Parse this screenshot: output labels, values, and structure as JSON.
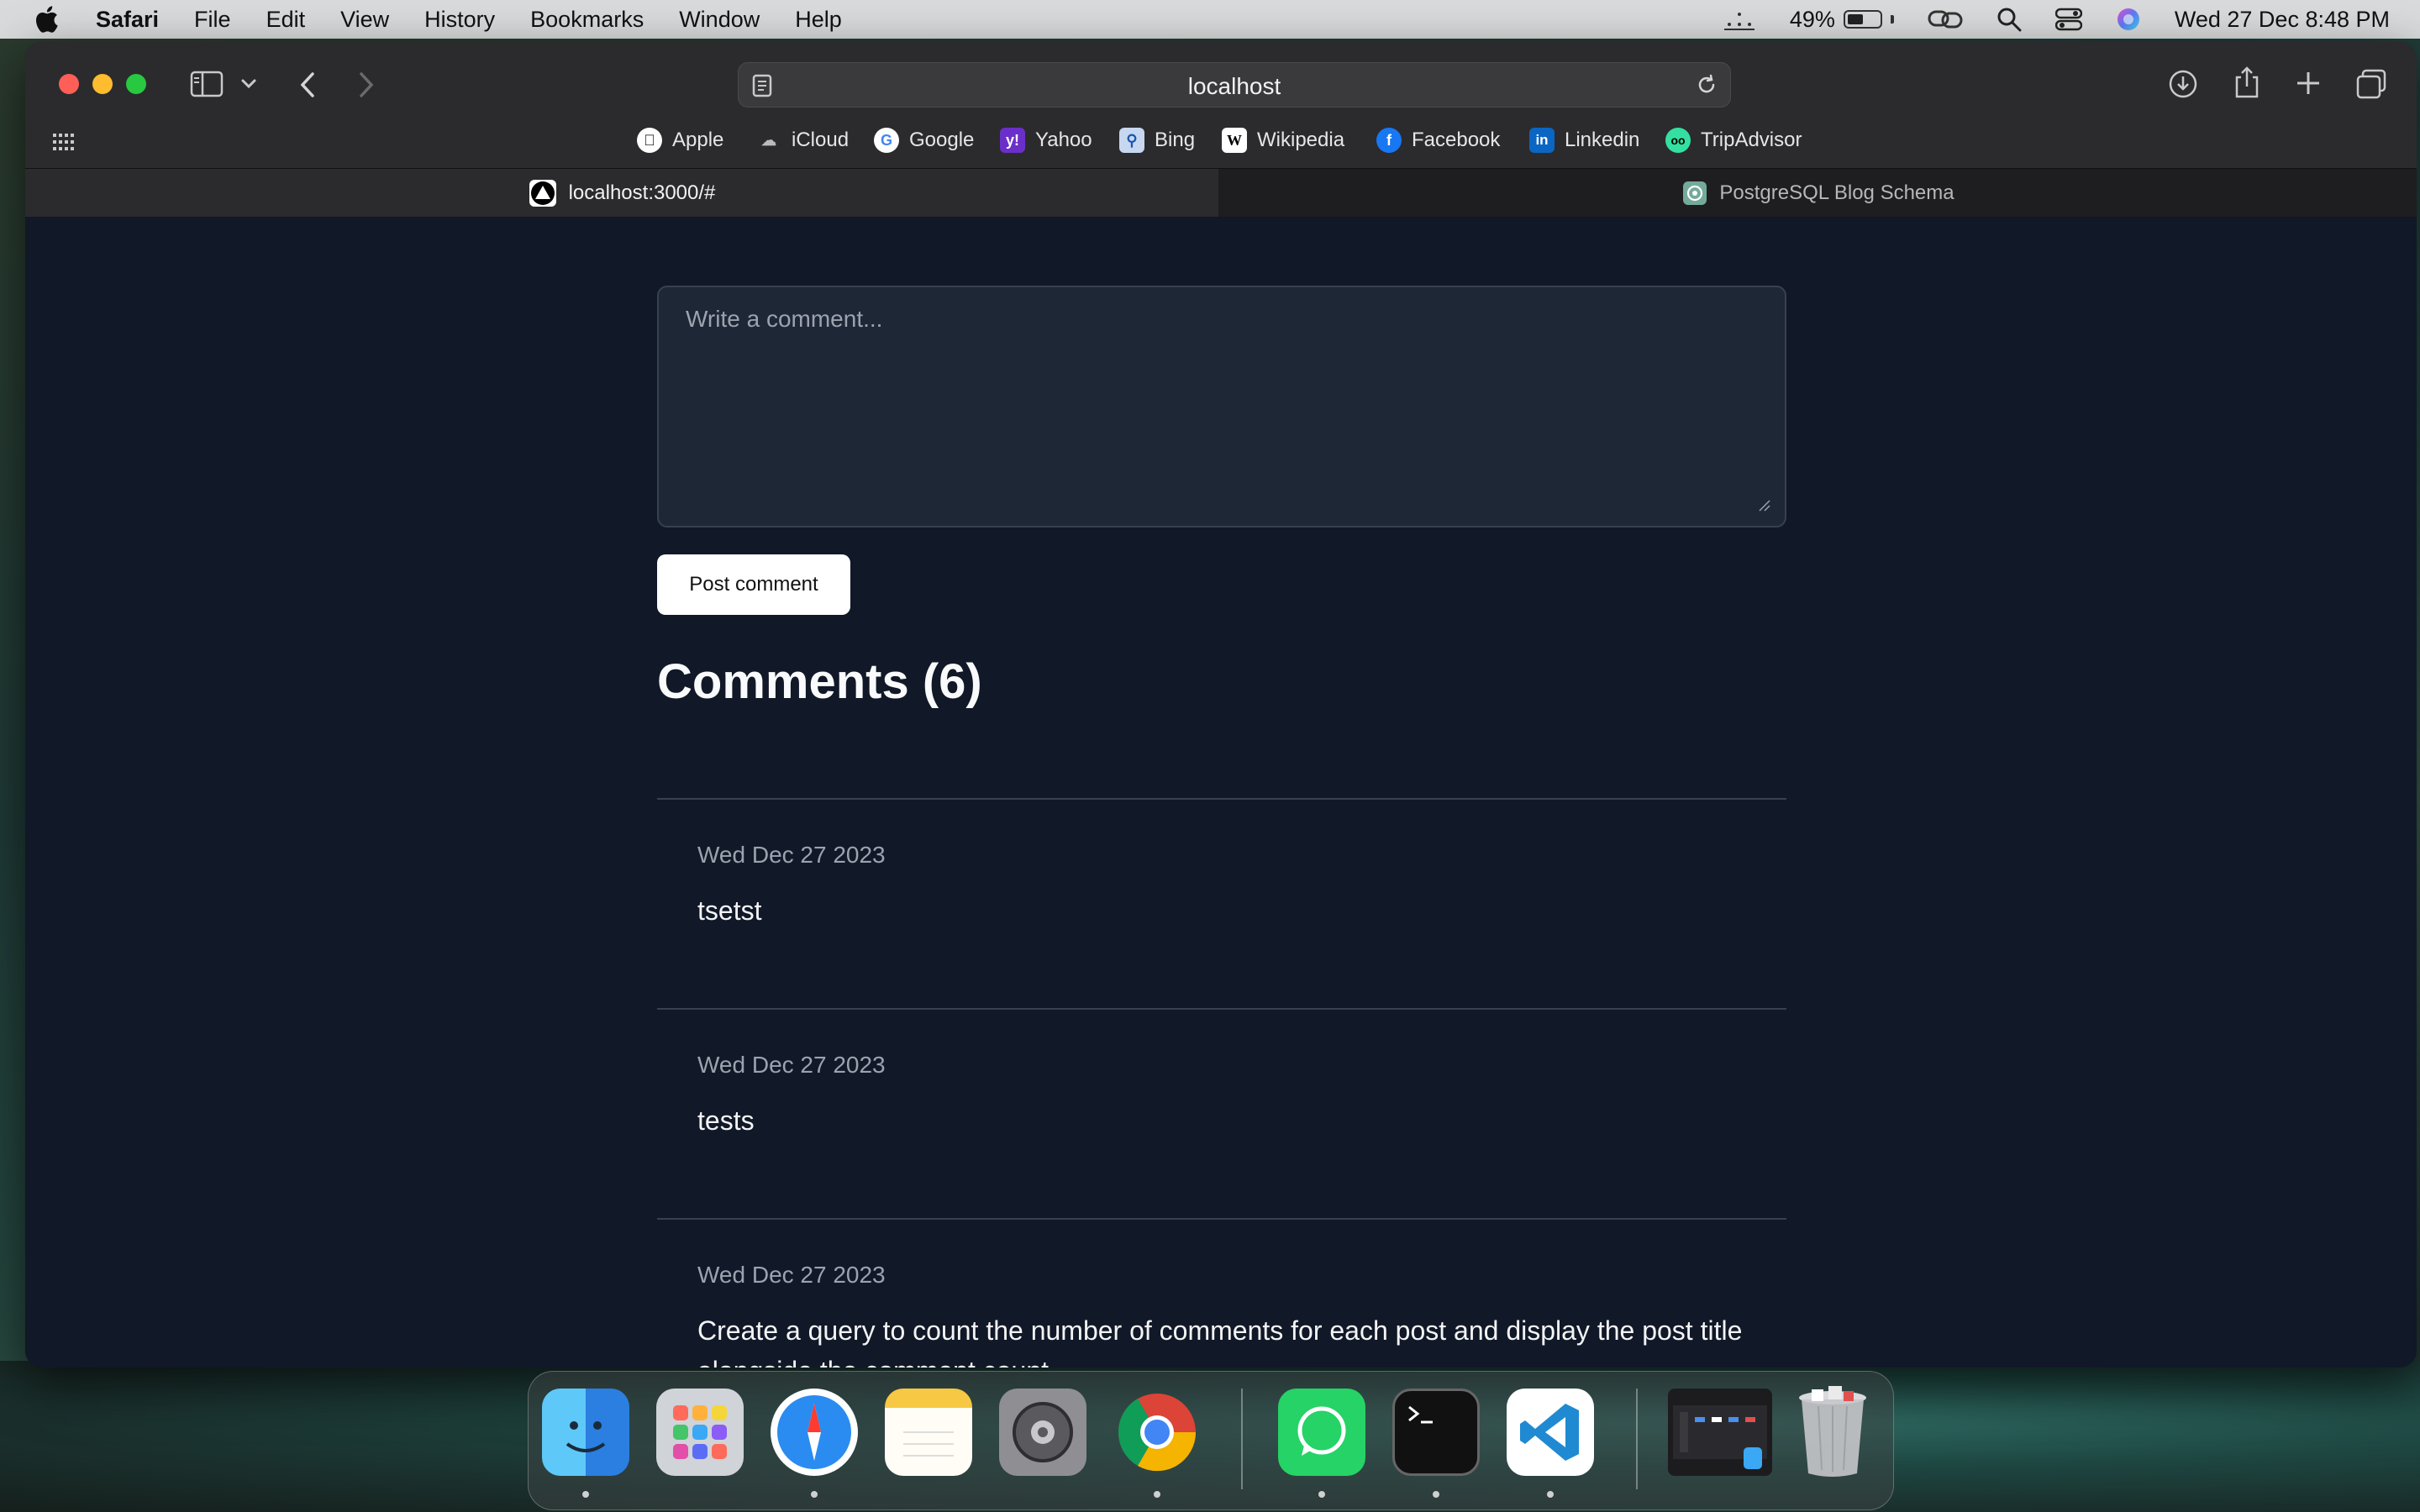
{
  "menubar": {
    "app_name": "Safari",
    "items": [
      "File",
      "Edit",
      "View",
      "History",
      "Bookmarks",
      "Window",
      "Help"
    ],
    "battery_percent": "49%",
    "battery_level": 0.49,
    "datetime": "Wed 27 Dec  8:48 PM"
  },
  "browser": {
    "address": "localhost",
    "favorites": [
      {
        "label": "Apple",
        "icon": "apple-icon"
      },
      {
        "label": "iCloud",
        "icon": "icloud-icon"
      },
      {
        "label": "Google",
        "icon": "google-icon"
      },
      {
        "label": "Yahoo",
        "icon": "yahoo-icon"
      },
      {
        "label": "Bing",
        "icon": "bing-icon"
      },
      {
        "label": "Wikipedia",
        "icon": "wikipedia-icon"
      },
      {
        "label": "Facebook",
        "icon": "facebook-icon"
      },
      {
        "label": "Linkedin",
        "icon": "linkedin-icon"
      },
      {
        "label": "TripAdvisor",
        "icon": "tripadvisor-icon"
      }
    ],
    "tabs": [
      {
        "label": "localhost:3000/#",
        "active": true
      },
      {
        "label": "PostgreSQL Blog Schema",
        "active": false
      }
    ]
  },
  "page": {
    "comment_placeholder": "Write a comment...",
    "post_button": "Post comment",
    "comments_heading": "Comments (6)",
    "comments": [
      {
        "date": "Wed Dec 27 2023",
        "text": "tsetst"
      },
      {
        "date": "Wed Dec 27 2023",
        "text": "tests"
      },
      {
        "date": "Wed Dec 27 2023",
        "text": "Create a query to count the number of comments for each post and display the post title alongside the comment count."
      }
    ]
  },
  "dock": {
    "apps": [
      "Finder",
      "Launchpad",
      "Safari",
      "Notes",
      "System Settings",
      "Chrome",
      "WhatsApp",
      "Terminal",
      "VS Code",
      "Downloads",
      "Trash"
    ]
  }
}
